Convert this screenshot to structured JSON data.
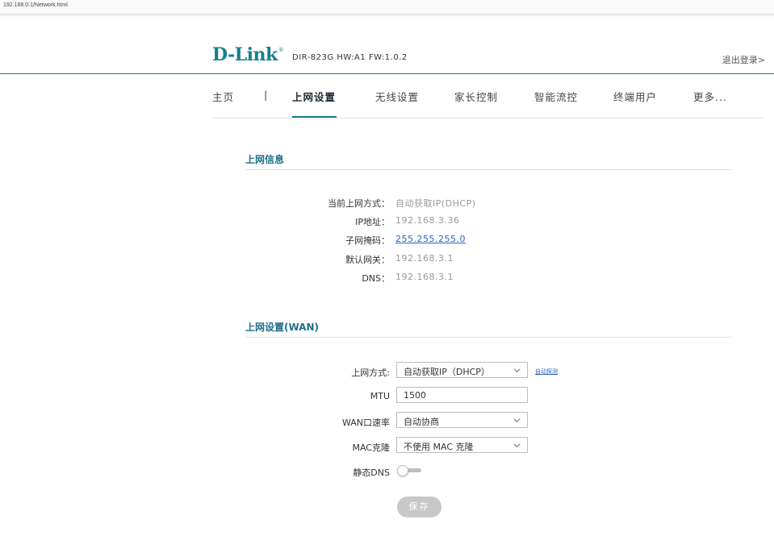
{
  "browser": {
    "url": "192.168.0.1/Network.html"
  },
  "header": {
    "brand": "D-Link",
    "model_info": "DIR-823G  HW:A1  FW:1.0.2",
    "logout": "退出登录>"
  },
  "nav": {
    "items": [
      "主页",
      "|",
      "上网设置",
      "无线设置",
      "家长控制",
      "智能流控",
      "终端用户",
      "更多..."
    ],
    "active": "上网设置"
  },
  "info_section": {
    "title": "上网信息",
    "rows": [
      {
        "label": "当前上网方式：",
        "value": "自动获取IP(DHCP)"
      },
      {
        "label": "IP地址：",
        "value": "192.168.3.36"
      },
      {
        "label": "子网掩码：",
        "value": "255.255.255.0"
      },
      {
        "label": "默认网关：",
        "value": "192.168.3.1"
      },
      {
        "label": "DNS：",
        "value": "192.168.3.1"
      }
    ]
  },
  "wan_section": {
    "title": "上网设置(WAN)",
    "connection_type": {
      "label": "上网方式:",
      "value": "自动获取IP（DHCP）",
      "autodetect": "自动探测"
    },
    "mtu": {
      "label": "MTU",
      "value": "1500"
    },
    "wan_speed": {
      "label": "WAN口速率",
      "value": "自动协商"
    },
    "mac_clone": {
      "label": "MAC克隆",
      "value": "不使用 MAC 克隆"
    },
    "static_dns": {
      "label": "静态DNS",
      "enabled": false
    },
    "save": "保存"
  },
  "colors": {
    "brand": "#16808f",
    "section_title": "#1e6f88",
    "link": "#2a64c6",
    "save_button": "#c8c8c8"
  }
}
